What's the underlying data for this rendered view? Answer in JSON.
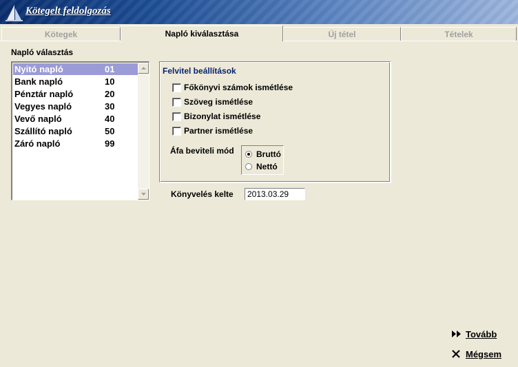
{
  "app": {
    "title": "Kötegelt feldolgozás"
  },
  "tabs": [
    {
      "label": "Kötegek",
      "active": false
    },
    {
      "label": "Napló kiválasztása",
      "active": true
    },
    {
      "label": "Új tétel",
      "active": false
    },
    {
      "label": "Tételek",
      "active": false
    }
  ],
  "journal_list": {
    "caption": "Napló választás",
    "items": [
      {
        "name": "Nyitó napló",
        "code": "01",
        "selected": true
      },
      {
        "name": "Bank napló",
        "code": "10",
        "selected": false
      },
      {
        "name": "Pénztár napló",
        "code": "20",
        "selected": false
      },
      {
        "name": "Vegyes napló",
        "code": "30",
        "selected": false
      },
      {
        "name": "Vevő napló",
        "code": "40",
        "selected": false
      },
      {
        "name": "Szállító napló",
        "code": "50",
        "selected": false
      },
      {
        "name": "Záró napló",
        "code": "99",
        "selected": false
      }
    ]
  },
  "settings": {
    "title": "Felvitel beállítások",
    "checkboxes": [
      {
        "label": "Főkönyvi számok ismétlése",
        "checked": false
      },
      {
        "label": "Szöveg ismétlése",
        "checked": false
      },
      {
        "label": "Bizonylat ismétlése",
        "checked": false
      },
      {
        "label": "Partner ismétlése",
        "checked": false
      }
    ],
    "vat_mode": {
      "label": "Áfa beviteli mód",
      "options": [
        {
          "label": "Bruttó",
          "selected": true
        },
        {
          "label": "Nettó",
          "selected": false
        }
      ]
    }
  },
  "posting_date": {
    "label": "Könyvelés kelte",
    "value": "2013.03.29"
  },
  "actions": {
    "next_label": "Tovább",
    "cancel_label": "Mégsem"
  },
  "colors": {
    "selection": "#9b9bd8",
    "group_title": "#0a2470",
    "window_bg": "#ece9d8"
  }
}
